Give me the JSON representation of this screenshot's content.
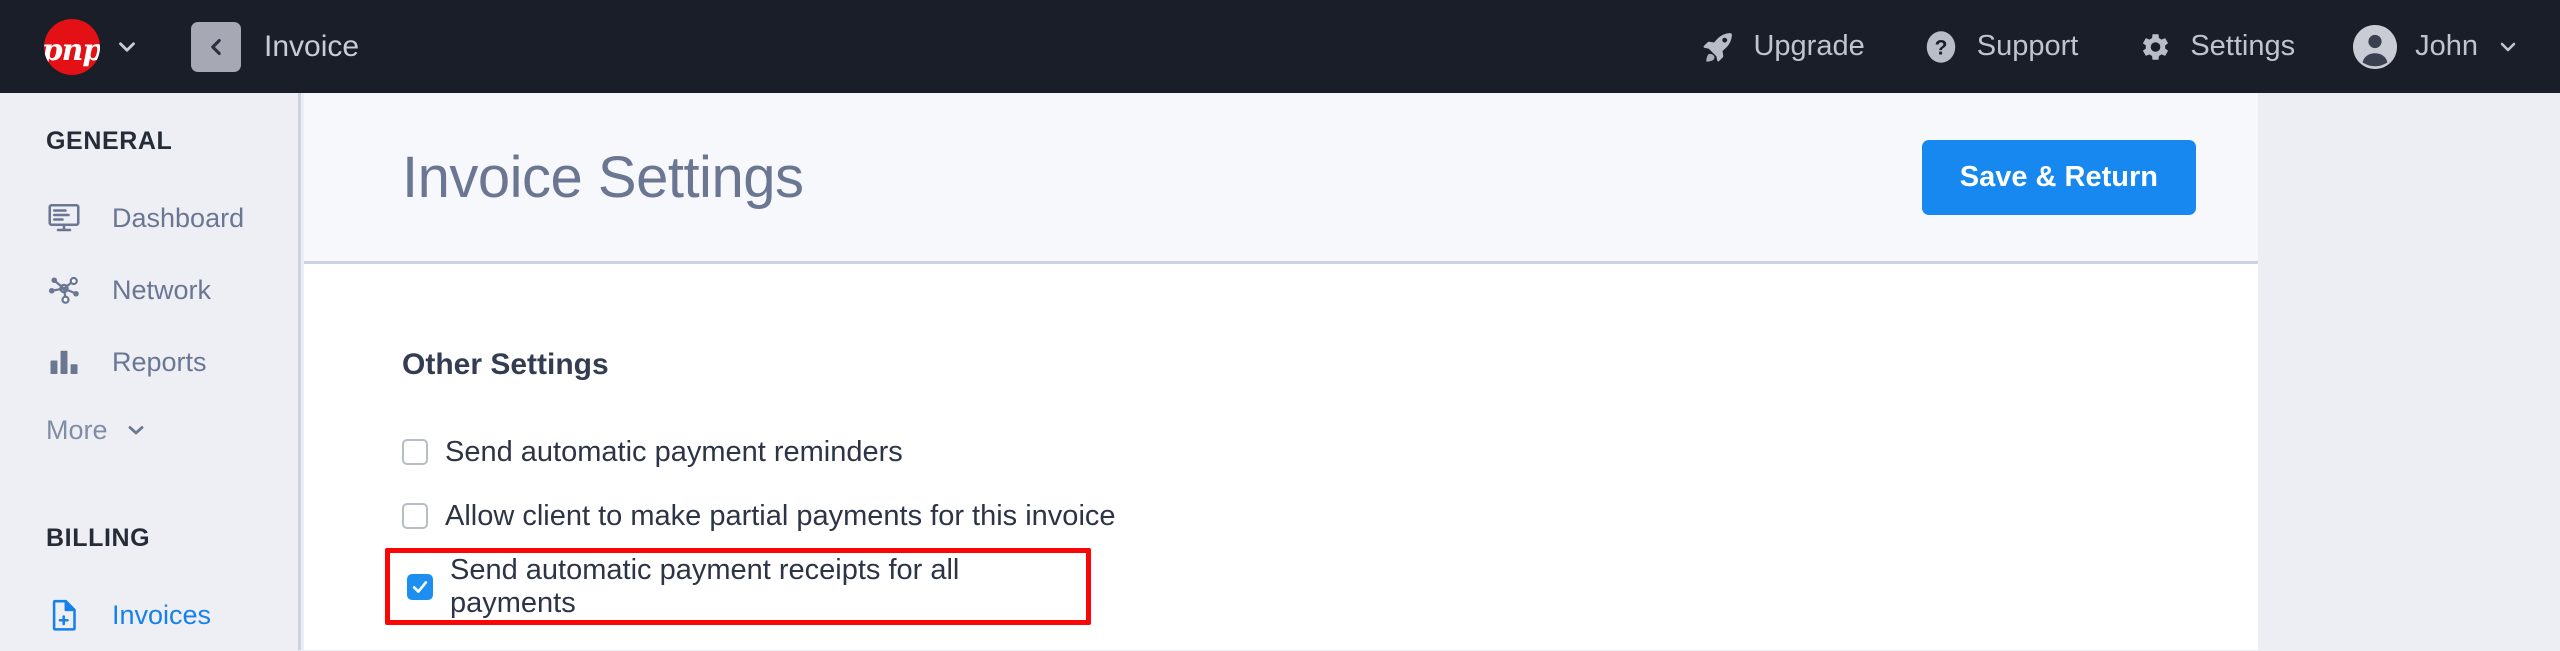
{
  "topbar": {
    "brand": {
      "logo_text": "pnp",
      "caret_icon": "chevron-down-icon"
    },
    "back": {
      "icon": "chevron-left-icon",
      "label": "Invoice"
    },
    "nav": [
      {
        "label": "Upgrade",
        "icon": "rocket-icon"
      },
      {
        "label": "Support",
        "icon": "question-circle-icon"
      },
      {
        "label": "Settings",
        "icon": "gear-icon"
      }
    ],
    "user": {
      "name": "John",
      "avatar_icon": "user-avatar-icon",
      "caret_icon": "chevron-down-icon"
    },
    "background_color": "#1a1e28"
  },
  "sidebar": {
    "general_heading": "GENERAL",
    "general_items": [
      {
        "label": "Dashboard",
        "icon": "monitor-icon",
        "active": false
      },
      {
        "label": "Network",
        "icon": "network-nodes-icon",
        "active": false
      },
      {
        "label": "Reports",
        "icon": "bar-chart-icon",
        "active": false
      }
    ],
    "more": {
      "label": "More",
      "icon": "chevron-down-icon"
    },
    "billing_heading": "BILLING",
    "billing_items": [
      {
        "label": "Invoices",
        "icon": "invoice-document-icon",
        "active": true
      }
    ],
    "active_color": "#1681e8",
    "background_color": "#eeeff5"
  },
  "main": {
    "page_title": "Invoice Settings",
    "save_button": "Save & Return",
    "save_button_color": "#1688f0",
    "section_title": "Other Settings",
    "checkboxes": [
      {
        "label": "Send automatic payment reminders",
        "checked": false,
        "highlighted": false
      },
      {
        "label": "Allow client to make partial payments for this invoice",
        "checked": false,
        "highlighted": false
      },
      {
        "label": "Send automatic payment receipts for all payments",
        "checked": true,
        "highlighted": true
      }
    ],
    "highlight_color": "#fb0606"
  }
}
